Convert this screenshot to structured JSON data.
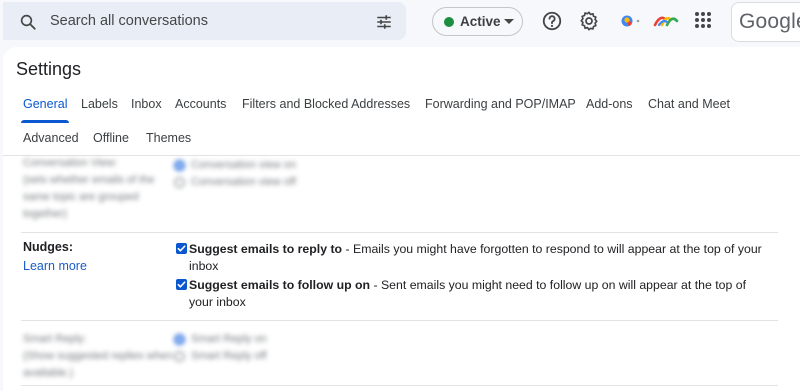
{
  "search": {
    "placeholder": "Search all conversations"
  },
  "status": {
    "label": "Active",
    "color": "#1e8e3e"
  },
  "brand": {
    "logo_text": "Google"
  },
  "settings": {
    "title": "Settings",
    "tabs_row1": [
      "General",
      "Labels",
      "Inbox",
      "Accounts",
      "Filters and Blocked Addresses",
      "Forwarding and POP/IMAP",
      "Add-ons",
      "Chat and Meet"
    ],
    "tabs_row2": [
      "Advanced",
      "Offline",
      "Themes"
    ],
    "active_tab": "General"
  },
  "blurred_top": {
    "label_lines": [
      "Conversation View:",
      "(sets whether emails of the",
      "same topic are grouped",
      "together)"
    ],
    "options": [
      "Conversation view on",
      "Conversation view off"
    ]
  },
  "nudges": {
    "title": "Nudges:",
    "learn_more": "Learn more",
    "option1_bold": "Suggest emails to reply to",
    "option1_rest": " - Emails you might have forgotten to respond to will appear at the top of your inbox",
    "option1_checked": true,
    "option2_bold": "Suggest emails to follow up on",
    "option2_rest": " - Sent emails you might need to follow up on will appear at the top of your inbox",
    "option2_checked": true
  },
  "blurred_bottom": {
    "label_lines": [
      "Smart Reply:",
      "(Show suggested replies when",
      "available.)"
    ],
    "options": [
      "Smart Reply on",
      "Smart Reply off"
    ]
  }
}
